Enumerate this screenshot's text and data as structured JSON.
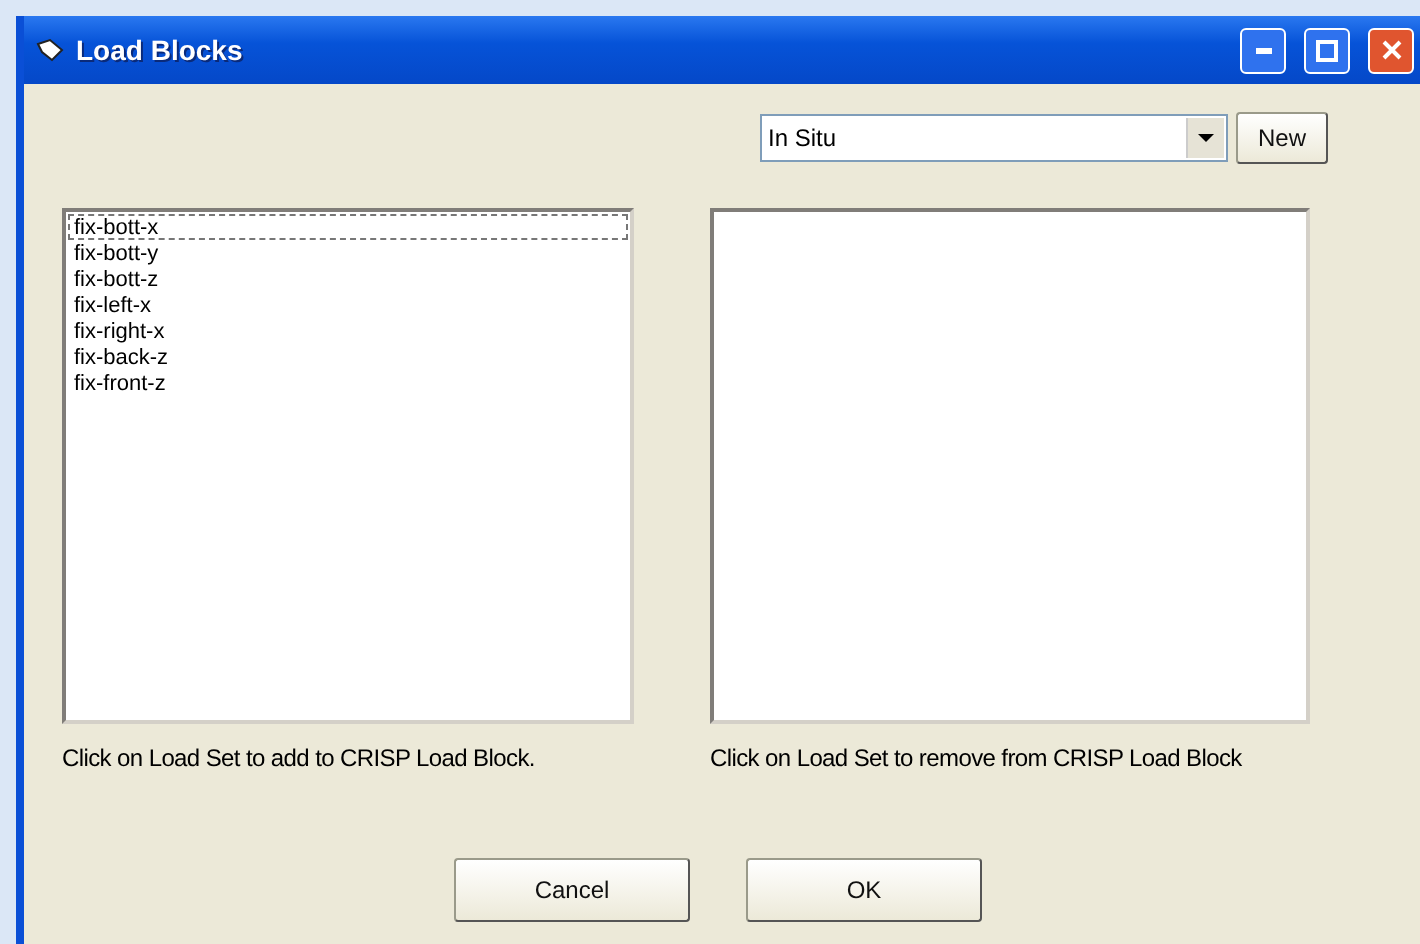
{
  "window": {
    "title": "Load Blocks"
  },
  "load_set_dropdown": {
    "value": "In Situ"
  },
  "new_button": "New",
  "available_list": {
    "items": [
      {
        "label": "fix-bott-x",
        "focused": true
      },
      {
        "label": "fix-bott-y",
        "focused": false
      },
      {
        "label": "fix-bott-z",
        "focused": false
      },
      {
        "label": "fix-left-x",
        "focused": false
      },
      {
        "label": "fix-right-x",
        "focused": false
      },
      {
        "label": "fix-back-z",
        "focused": false
      },
      {
        "label": "fix-front-z",
        "focused": false
      }
    ],
    "caption": "Click on Load Set to add to CRISP Load Block."
  },
  "block_list": {
    "caption": "Click on Load Set to remove from CRISP Load Block"
  },
  "buttons": [
    "Cancel",
    "OK"
  ]
}
